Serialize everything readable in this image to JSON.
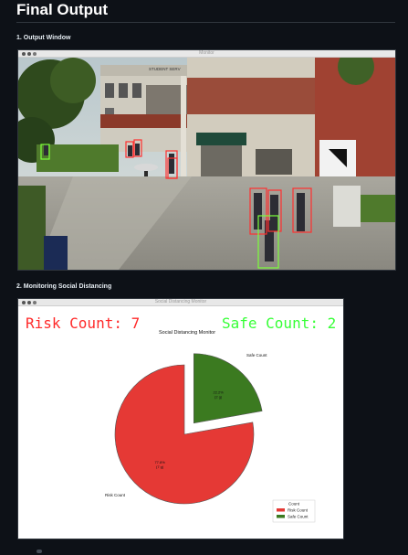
{
  "page": {
    "title": "Final Output",
    "section1": "1. Output Window",
    "section2": "2. Monitoring Social Distancing"
  },
  "output_window": {
    "title": "Monitor",
    "detections": [
      {
        "status": "safe"
      },
      {
        "status": "risk"
      },
      {
        "status": "risk"
      },
      {
        "status": "risk"
      },
      {
        "status": "risk"
      },
      {
        "status": "risk"
      },
      {
        "status": "risk"
      },
      {
        "status": "risk"
      },
      {
        "status": "safe"
      }
    ],
    "sign_text": "STUDENT SERV",
    "colors": {
      "risk": "#ff3030",
      "safe": "#7cff3a"
    }
  },
  "monitor_window": {
    "title": "Social Distancing Monitor",
    "risk_text": "Risk Count: 7",
    "safe_text": "Safe Count: 2",
    "risk_color": "#ff2a2a",
    "safe_color": "#37ff37"
  },
  "chart_data": {
    "type": "pie",
    "title": "Social Distancing Monitor",
    "slices": [
      {
        "label": "Risk Count",
        "value": 7,
        "pct_text": "77.8%",
        "count_text": "(7 g)",
        "color": "#e53935",
        "exploded": false
      },
      {
        "label": "Safe Count",
        "value": 2,
        "pct_text": "22.2%",
        "count_text": "(2 g)",
        "color": "#3b7a20",
        "exploded": true
      }
    ],
    "legend": {
      "title": "Count",
      "position": "lower-right",
      "entries": [
        "Risk Count",
        "Safe Count"
      ]
    }
  }
}
